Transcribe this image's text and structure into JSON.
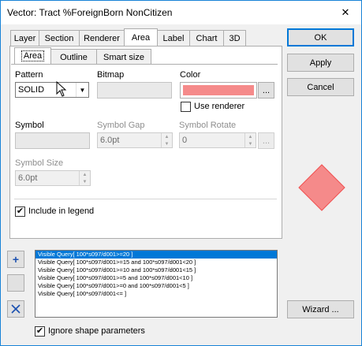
{
  "window": {
    "title": "Vector: Tract %ForeignBorn NonCitizen",
    "close_glyph": "✕"
  },
  "tabs": [
    "Layer",
    "Section",
    "Renderer",
    "Area",
    "Label",
    "Chart",
    "3D"
  ],
  "subtabs": [
    "Area",
    "Outline",
    "Smart size"
  ],
  "area": {
    "pattern_label": "Pattern",
    "pattern_value": "SOLID",
    "bitmap_label": "Bitmap",
    "color_label": "Color",
    "color_hex": "#f58a8a",
    "ellipsis": "...",
    "use_renderer_label": "Use renderer",
    "symbol_label": "Symbol",
    "symbol_gap_label": "Symbol Gap",
    "symbol_gap_value": "6.0pt",
    "symbol_rotate_label": "Symbol Rotate",
    "symbol_rotate_value": "0",
    "symbol_size_label": "Symbol Size",
    "symbol_size_value": "6.0pt",
    "include_legend_label": "Include in legend",
    "include_legend_checked": true
  },
  "buttons": {
    "ok": "OK",
    "apply": "Apply",
    "cancel": "Cancel",
    "wizard": "Wizard ...",
    "add": "+"
  },
  "preview": {
    "fill": "#f58a8a",
    "border": "#f05050"
  },
  "queries": [
    "Visible Query[ 100*s097/d001>=20 ]",
    "Visible Query[ 100*s097/d001>=15 and 100*s097/d001<20 ]",
    "Visible Query[ 100*s097/d001>=10 and 100*s097/d001<15 ]",
    "Visible Query[ 100*s097/d001>=5 and 100*s097/d001<10 ]",
    "Visible Query[ 100*s097/d001>=0 and 100*s097/d001<5 ]",
    "Visible Query[ 100*s097/d001<= ]"
  ],
  "ignore_shape_label": "Ignore shape parameters",
  "ignore_shape_checked": true,
  "check_glyph": "✔",
  "dropdown_glyph": "▼",
  "spin_up_glyph": "▲",
  "spin_down_glyph": "▼"
}
